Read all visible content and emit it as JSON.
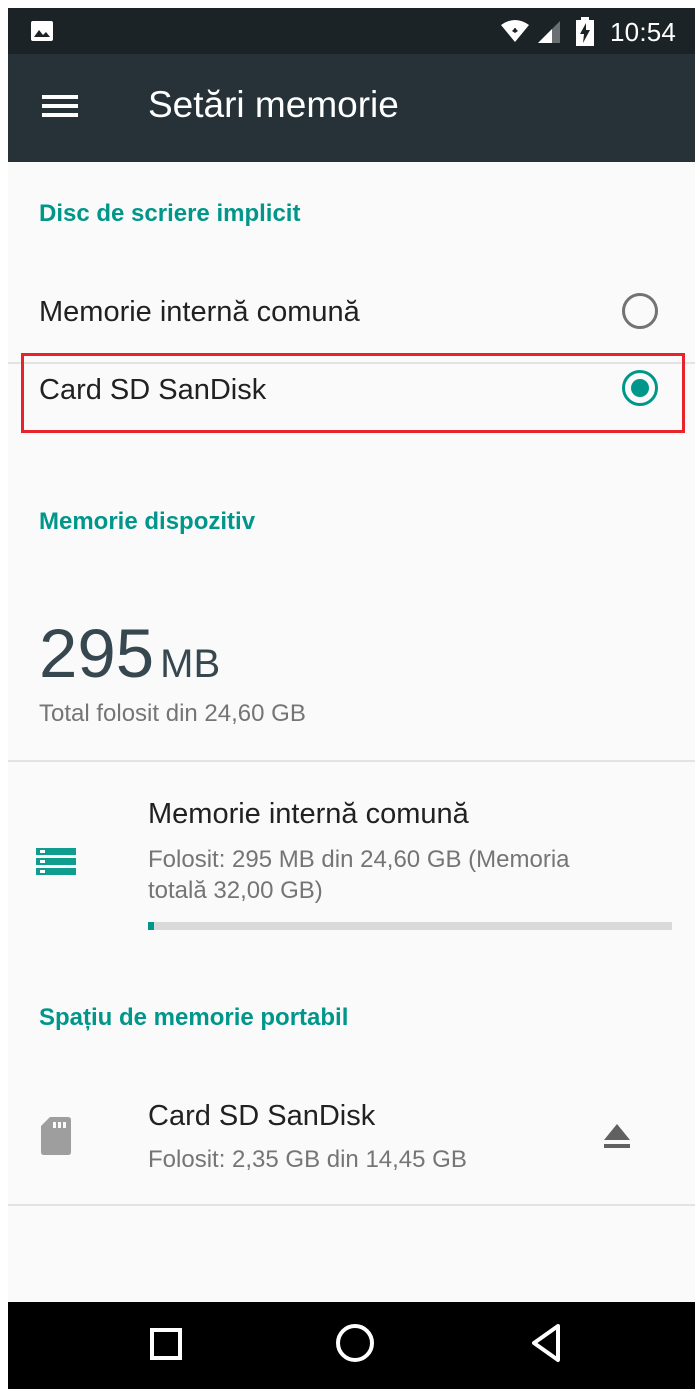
{
  "status_bar": {
    "time": "10:54",
    "icons": [
      "image-notification-icon",
      "wifi-icon",
      "signal-icon",
      "battery-charging-icon"
    ]
  },
  "toolbar": {
    "title": "Setări memorie",
    "menu_icon": "hamburger-menu-icon"
  },
  "default_write_disk": {
    "header": "Disc de scriere implicit",
    "options": [
      {
        "label": "Memorie internă comună",
        "selected": false
      },
      {
        "label": "Card SD SanDisk",
        "selected": true
      }
    ]
  },
  "device_memory": {
    "header": "Memorie dispozitiv",
    "used_value": "295",
    "used_unit": "MB",
    "total_text": "Total folosit din 24,60 GB",
    "internal": {
      "title": "Memorie internă comună",
      "summary_line1": "Folosit: 295 MB din 24,60 GB (Memoria",
      "summary_line2": "totală 32,00 GB)",
      "usage_fraction": 0.012
    }
  },
  "portable_storage": {
    "header": "Spațiu de memorie portabil",
    "sd_card": {
      "title": "Card SD SanDisk",
      "summary": "Folosit: 2,35 GB din 14,45 GB",
      "action_icon": "eject-icon"
    }
  },
  "nav_bar": {
    "buttons": [
      "recents-square-icon",
      "home-circle-icon",
      "back-triangle-icon"
    ]
  },
  "colors": {
    "accent": "#00968a",
    "toolbar": "#263238",
    "status_bar": "#1b2327",
    "highlight": "#e8232b"
  }
}
